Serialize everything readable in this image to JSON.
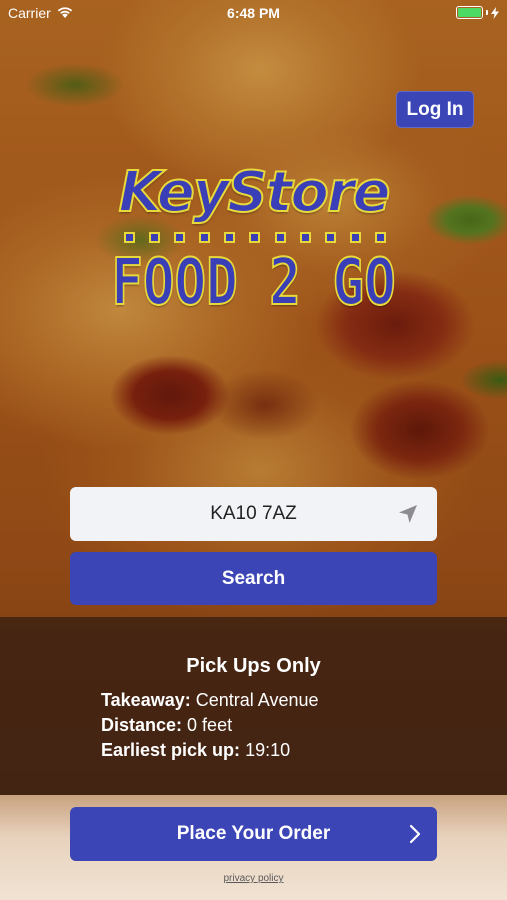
{
  "status_bar": {
    "carrier": "Carrier",
    "time": "6:48 PM",
    "battery_color": "#4cd964"
  },
  "header": {
    "login_label": "Log In"
  },
  "logo": {
    "line1": "KeyStore",
    "line2": "FOOD 2 GO",
    "primary_color": "#3a3fb8",
    "outline_color": "#e8d93a"
  },
  "search": {
    "postcode_value": "KA10 7AZ",
    "locate_icon": "location-arrow-icon",
    "button_label": "Search"
  },
  "info": {
    "title": "Pick Ups Only",
    "rows": [
      {
        "label": "Takeaway:",
        "value": "Central Avenue"
      },
      {
        "label": "Distance:",
        "value": "0 feet"
      },
      {
        "label": "Earliest pick up:",
        "value": "19:10"
      }
    ]
  },
  "order": {
    "button_label": "Place Your Order",
    "chevron_icon": "chevron-right-icon"
  },
  "footer": {
    "privacy_label": "privacy policy"
  },
  "colors": {
    "accent": "#3b45b6"
  }
}
